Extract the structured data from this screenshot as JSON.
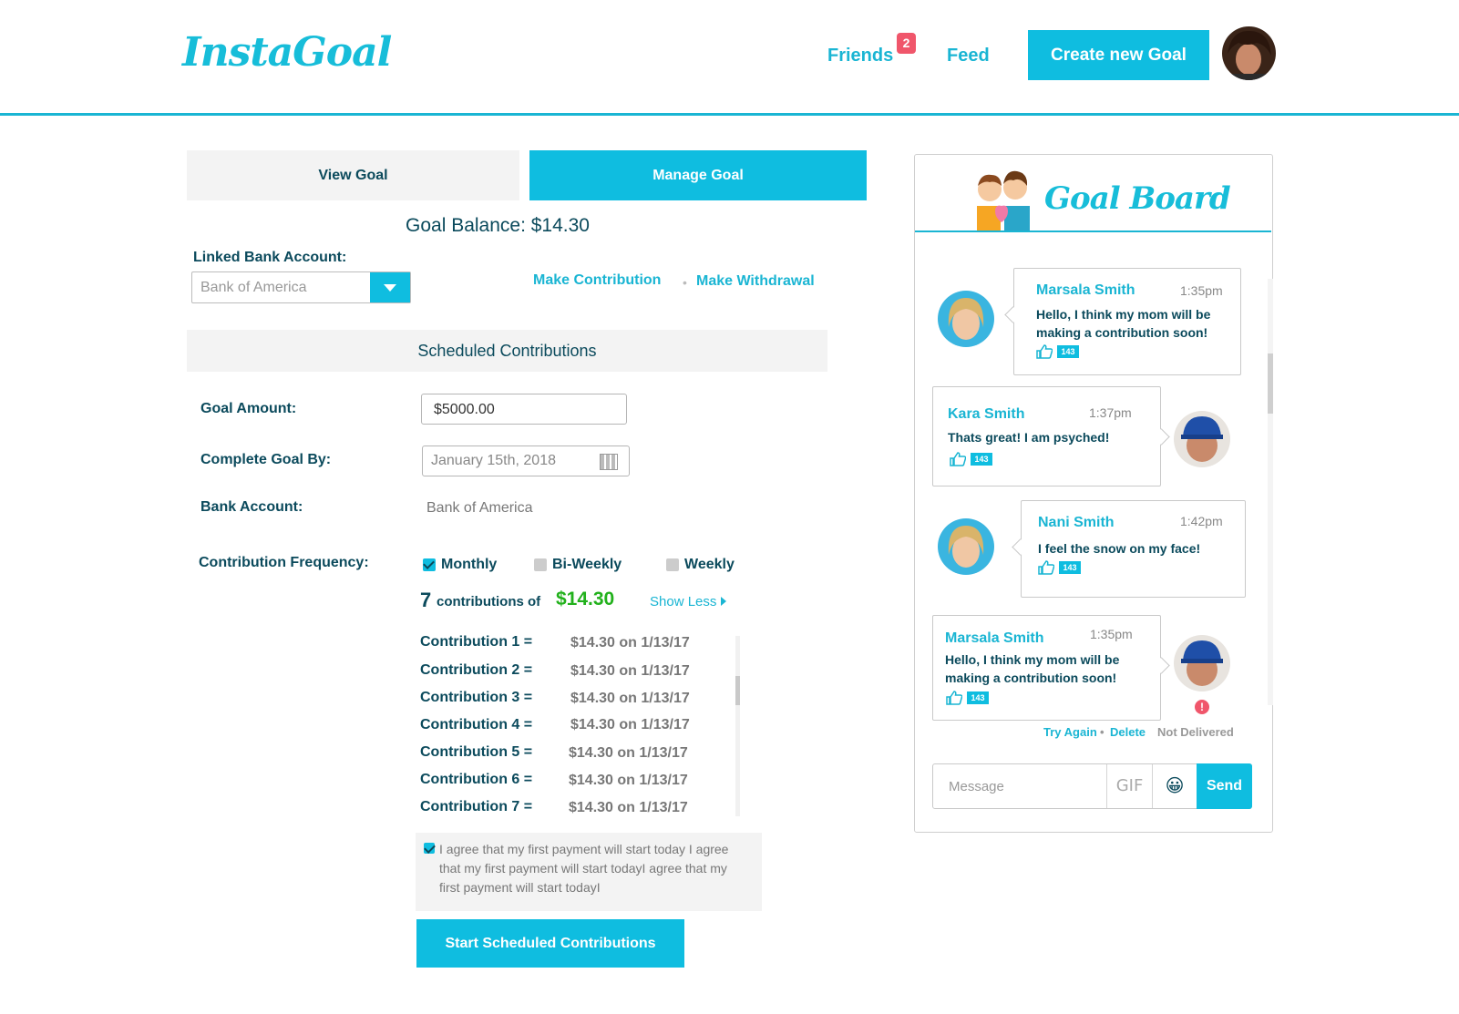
{
  "header": {
    "logo": "InstaGoal",
    "nav": {
      "friends": "Friends",
      "friends_badge": "2",
      "feed": "Feed"
    },
    "create_button": "Create new Goal"
  },
  "tabs": {
    "view": "View Goal",
    "manage": "Manage Goal"
  },
  "balance": "Goal Balance: $14.30",
  "linked_bank": {
    "label": "Linked Bank Account:",
    "selected": "Bank of America"
  },
  "actions": {
    "contribution": "Make Contribution",
    "separator": "•",
    "withdrawal": "Make Withdrawal"
  },
  "scheduled_title": "Scheduled Contributions",
  "form": {
    "goal_amount_label": "Goal Amount:",
    "goal_amount_value": "$5000.00",
    "complete_by_label": "Complete Goal By:",
    "complete_by_value": "January 15th, 2018",
    "bank_label": "Bank Account:",
    "bank_value": "Bank of America",
    "frequency_label": "Contribution Frequency:",
    "frequency_options": [
      {
        "label": "Monthly",
        "checked": true
      },
      {
        "label": "Bi-Weekly",
        "checked": false
      },
      {
        "label": "Weekly",
        "checked": false
      }
    ]
  },
  "summary": {
    "count": "7",
    "text": "contributions of",
    "amount": "$14.30",
    "show_less": "Show Less"
  },
  "contributions": [
    {
      "label": "Contribution 1 =",
      "value": "$14.30 on 1/13/17"
    },
    {
      "label": "Contribution 2 =",
      "value": "$14.30 on 1/13/17"
    },
    {
      "label": "Contribution 3 =",
      "value": "$14.30 on 1/13/17"
    },
    {
      "label": "Contribution 4 =",
      "value": "$14.30 on 1/13/17"
    },
    {
      "label": "Contribution 5 =",
      "value": "$14.30 on 1/13/17"
    },
    {
      "label": "Contribution 6 =",
      "value": "$14.30 on 1/13/17"
    },
    {
      "label": "Contribution 7 =",
      "value": "$14.30 on 1/13/17"
    }
  ],
  "agreement": {
    "checked": true,
    "text": "I agree that my first payment will start today I agree that my first payment will start todayI agree that my first payment will start todayI"
  },
  "start_button": "Start Scheduled Contributions",
  "board": {
    "title": "Goal Board",
    "messages": [
      {
        "name": "Marsala Smith",
        "time": "1:35pm",
        "text": "Hello, I think my mom will be making a contribution soon!",
        "likes": "143"
      },
      {
        "name": "Kara Smith",
        "time": "1:37pm",
        "text": "Thats great! I am psyched!",
        "likes": "143"
      },
      {
        "name": "Nani Smith",
        "time": "1:42pm",
        "text": "I feel the snow on my face!",
        "likes": "143"
      },
      {
        "name": "Marsala Smith",
        "time": "1:35pm",
        "text": "Hello, I think my mom will be making a contribution soon!",
        "likes": "143"
      }
    ],
    "error": {
      "mark": "!",
      "try_again": "Try Again",
      "separator": "•",
      "delete": "Delete",
      "status": "Not Delivered"
    },
    "composer": {
      "placeholder": "Message",
      "gif": "GIF",
      "emoji": "😀",
      "send": "Send"
    }
  },
  "colors": {
    "accent": "#0fbde0",
    "text_dark": "#0b4a5c",
    "money_green": "#22b11c",
    "error": "#f0566b"
  }
}
